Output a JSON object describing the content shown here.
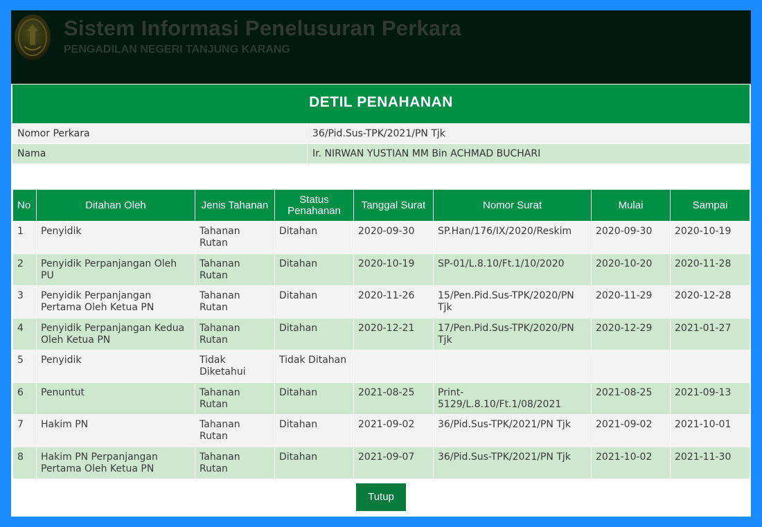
{
  "header": {
    "title": "Sistem Informasi Penelusuran Perkara",
    "subtitle": "PENGADILAN NEGERI TANJUNG KARANG"
  },
  "detail": {
    "title": "DETIL PENAHANAN",
    "info": [
      {
        "label": "Nomor Perkara",
        "value": "36/Pid.Sus-TPK/2021/PN Tjk"
      },
      {
        "label": "Nama",
        "value": "Ir. NIRWAN YUSTIAN MM Bin ACHMAD BUCHARI"
      }
    ]
  },
  "table": {
    "headers": [
      "No",
      "Ditahan Oleh",
      "Jenis Tahanan",
      "Status Penahanan",
      "Tanggal Surat",
      "Nomor Surat",
      "Mulai",
      "Sampai"
    ],
    "rows": [
      [
        "1",
        "Penyidik",
        "Tahanan Rutan",
        "Ditahan",
        "2020-09-30",
        "SP.Han/176/IX/2020/Reskim",
        "2020-09-30",
        "2020-10-19"
      ],
      [
        "2",
        "Penyidik Perpanjangan Oleh PU",
        "Tahanan Rutan",
        "Ditahan",
        "2020-10-19",
        "SP-01/L.8.10/Ft.1/10/2020",
        "2020-10-20",
        "2020-11-28"
      ],
      [
        "3",
        "Penyidik Perpanjangan Pertama Oleh Ketua PN",
        "Tahanan Rutan",
        "Ditahan",
        "2020-11-26",
        "15/Pen.Pid.Sus-TPK/2020/PN Tjk",
        "2020-11-29",
        "2020-12-28"
      ],
      [
        "4",
        "Penyidik Perpanjangan Kedua Oleh Ketua PN",
        "Tahanan Rutan",
        "Ditahan",
        "2020-12-21",
        "17/Pen.Pid.Sus-TPK/2020/PN Tjk",
        "2020-12-29",
        "2021-01-27"
      ],
      [
        "5",
        "Penyidik",
        "Tidak Diketahui",
        "Tidak Ditahan",
        "",
        "",
        "",
        ""
      ],
      [
        "6",
        "Penuntut",
        "Tahanan Rutan",
        "Ditahan",
        "2021-08-25",
        "Print-5129/L.8.10/Ft.1/08/2021",
        "2021-08-25",
        "2021-09-13"
      ],
      [
        "7",
        "Hakim PN",
        "Tahanan Rutan",
        "Ditahan",
        "2021-09-02",
        "36/Pid.Sus-TPK/2021/PN Tjk",
        "2021-09-02",
        "2021-10-01"
      ],
      [
        "8",
        "Hakim PN Perpanjangan Pertama Oleh Ketua PN",
        "Tahanan Rutan",
        "Ditahan",
        "2021-09-07",
        "36/Pid.Sus-TPK/2021/PN Tjk",
        "2021-10-02",
        "2021-11-30"
      ]
    ]
  },
  "buttons": {
    "close_label": "Tutup"
  },
  "icons": {
    "logo": "court-emblem-icon"
  },
  "colors": {
    "accent": "#009045",
    "header_bg": "#021a0d",
    "row_alt": "#cde8cf",
    "row": "#f3f3f3",
    "frame": "#1a8cff"
  }
}
